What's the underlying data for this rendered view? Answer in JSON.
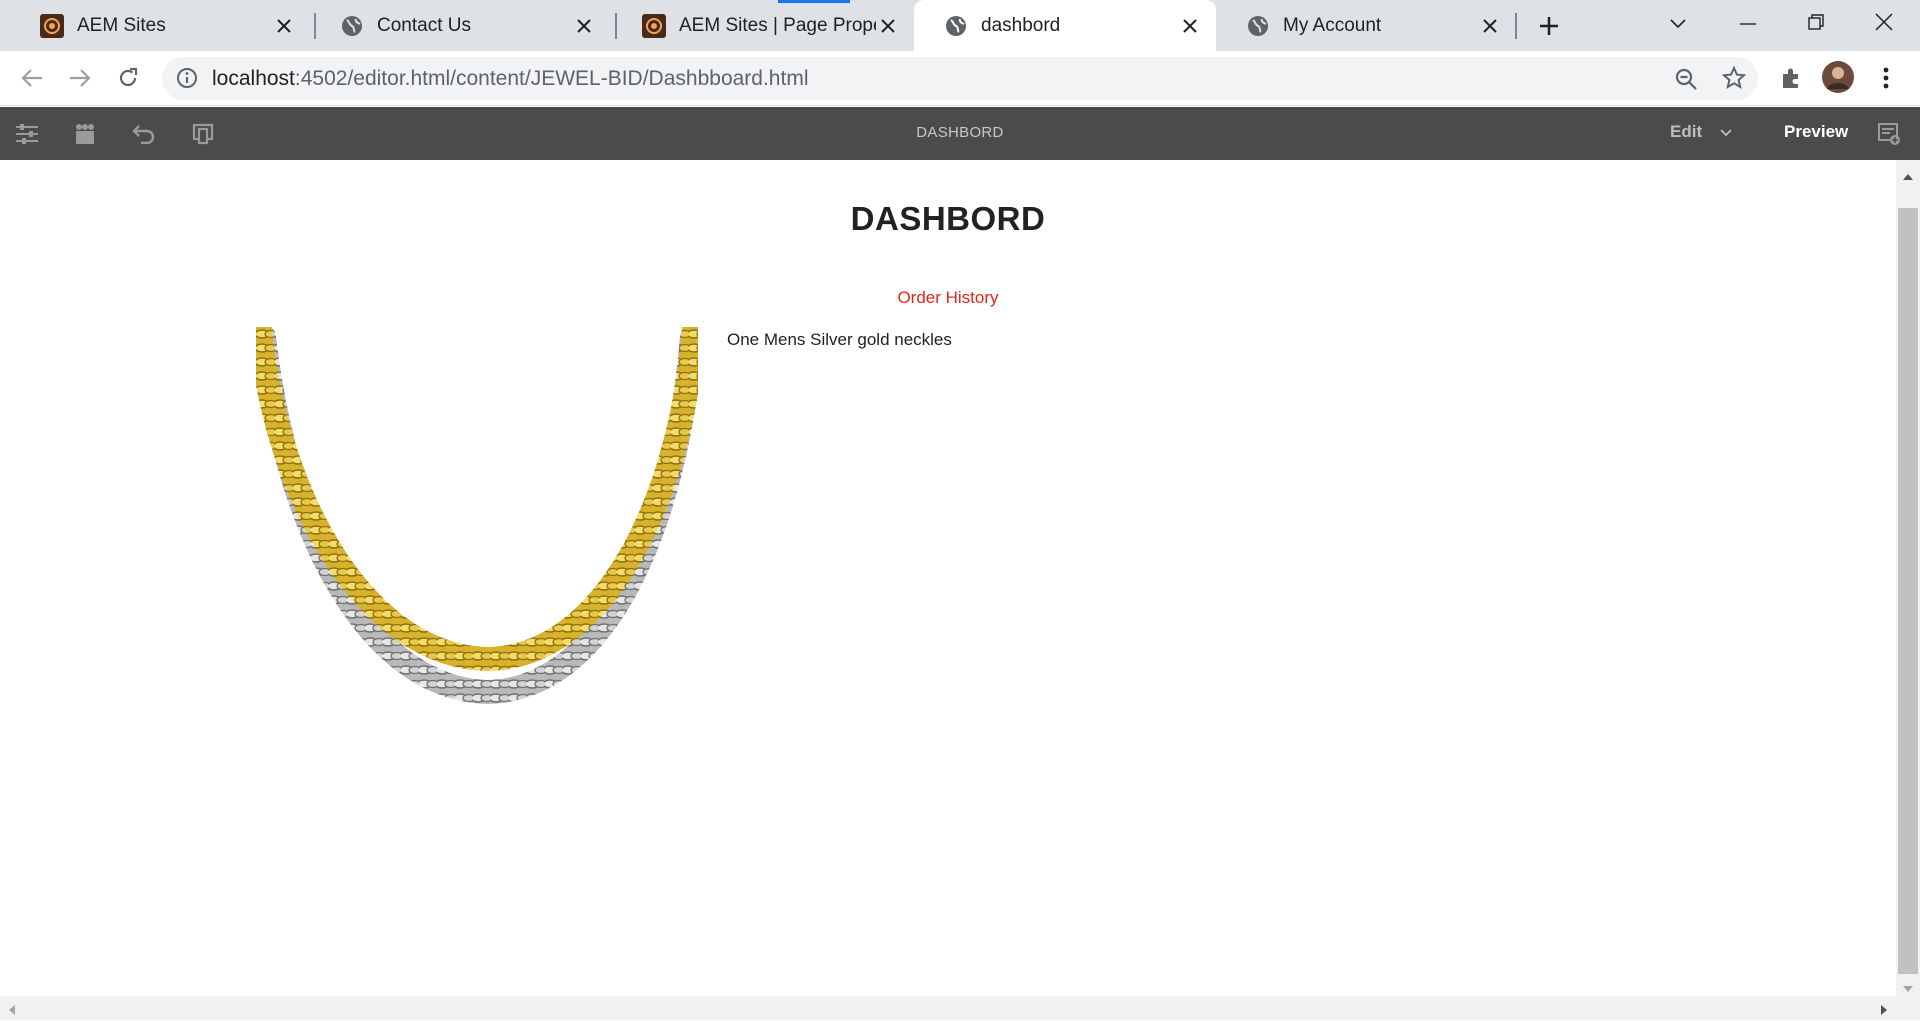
{
  "browser": {
    "tabs": [
      {
        "title": "AEM Sites",
        "favicon": "aem-icon",
        "active": false
      },
      {
        "title": "Contact Us",
        "favicon": "globe-icon",
        "active": false
      },
      {
        "title": "AEM Sites | Page Properti",
        "favicon": "aem-icon",
        "active": false
      },
      {
        "title": "dashbord",
        "favicon": "globe-icon",
        "active": true
      },
      {
        "title": "My Account",
        "favicon": "globe-icon",
        "active": false
      }
    ],
    "url_host": "localhost",
    "url_rest": ":4502/editor.html/content/JEWEL-BID/Dashbboard.html"
  },
  "editor": {
    "page_name": "DASHBORD",
    "mode_label": "Edit",
    "preview_label": "Preview"
  },
  "page": {
    "heading": "DASHBORD",
    "link_label": "Order History",
    "link_color": "#e1251b",
    "product_text": "One Mens Silver gold neckles"
  },
  "colors": {
    "tabstrip": "#dee1e6",
    "editor_bar": "#4b4b4b",
    "gold": "#e7c43a",
    "silver": "#a8a8a8"
  }
}
